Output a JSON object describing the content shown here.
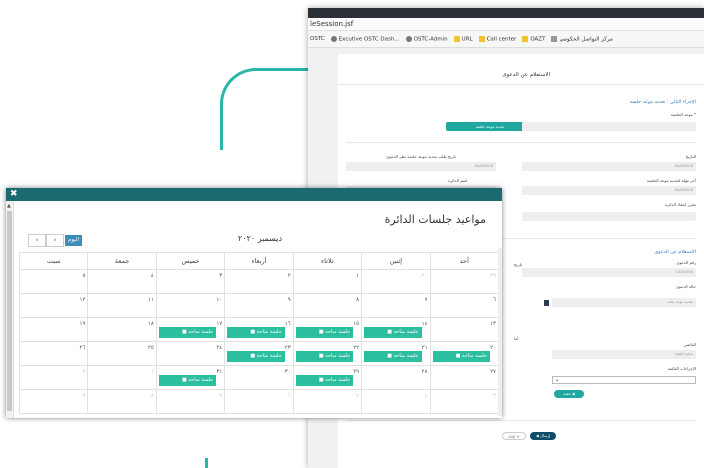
{
  "browser": {
    "url": "leSession.jsf",
    "bookmarks": [
      "OSTC",
      "Excutive OSTC Dash...",
      "OSTC-Admin",
      "URL",
      "Call center",
      "OAZT",
      "مركز التواصل الحكومي"
    ]
  },
  "form": {
    "page_title": "الاستعلام عن الدعوى",
    "section_action": "الإجراء التالي : تحديد موعد جلسة",
    "session_date_label": "موعد الجلسة *",
    "set_date_button": "تحديد موعد جلسة",
    "date_label": "التاريخ",
    "date_value": "00/00/000",
    "req_date_label": "تاريخ طلب تحديد موعد جلسة نظر الدعوى",
    "req_date_value": "00/00/000",
    "last_deadline_label": "آخر مهلة لتحديد موعد الجلسة",
    "last_deadline_value": "00/00/000",
    "circuit_label": "اسم الدائرة",
    "circuit_value": "",
    "circuit_members_label": "مقرر انعقاد الدائرة",
    "section_inquiry": "الاستعلام عن الدعوى",
    "case_no_label": "رقم الدعوى",
    "case_no_value": "1400/000",
    "case_status_label": "حالة الدعوى",
    "case_status_value": "جلسة موعد عامة",
    "judge_label": "القاضي",
    "judge_value": "تسلية اللجنة",
    "procedures_label": "الإجراءات القائمة",
    "procedures_select": "⌄",
    "next_chip": "تنفيذ ◀",
    "send_button": "◀ إرسال",
    "back_button": "إلغاء ✕",
    "side_label_1": "تاريخ",
    "side_label_2": "أما"
  },
  "calendar": {
    "window_close": "✖",
    "title": "مواعيد جلسات الدائرة",
    "month_label": "ديسمبر ٢٠٢٠",
    "today_label": "اليوم",
    "prev": "‹",
    "next": "›",
    "weekdays": [
      "سبت",
      "جمعة",
      "خميس",
      "أربعاء",
      "ثلاثاء",
      "إثنين",
      "أحد"
    ],
    "weeks": [
      [
        {
          "d": "٥"
        },
        {
          "d": "٤"
        },
        {
          "d": "٣"
        },
        {
          "d": "٢"
        },
        {
          "d": "١"
        },
        {
          "d": "٣٠",
          "f": true
        },
        {
          "d": "٢٩",
          "f": true
        }
      ],
      [
        {
          "d": "١٢"
        },
        {
          "d": "١١"
        },
        {
          "d": "١٠"
        },
        {
          "d": "٩"
        },
        {
          "d": "٨"
        },
        {
          "d": "٧"
        },
        {
          "d": "٦"
        }
      ],
      [
        {
          "d": "١٩"
        },
        {
          "d": "١٨"
        },
        {
          "d": "١٧",
          "ev": "■ جلسة متاحة"
        },
        {
          "d": "١٦",
          "ev": "■ جلسة متاحة"
        },
        {
          "d": "١٥",
          "ev": "■ جلسة متاحة"
        },
        {
          "d": "١٤",
          "ev": "■ جلسة متاحة"
        },
        {
          "d": "١٣"
        }
      ],
      [
        {
          "d": "٢٦"
        },
        {
          "d": "٢٥"
        },
        {
          "d": "٢٤"
        },
        {
          "d": "٢٣",
          "ev": "■ جلسة متاحة"
        },
        {
          "d": "٢٢",
          "ev": "■ جلسة متاحة"
        },
        {
          "d": "٢١",
          "ev": "■ جلسة متاحة"
        },
        {
          "d": "٢٠",
          "ev": "■ جلسة متاحة"
        }
      ],
      [
        {
          "d": "٢",
          "f": true
        },
        {
          "d": "١",
          "f": true
        },
        {
          "d": "٣١",
          "ev": "■ جلسة متاحة"
        },
        {
          "d": "٣٠"
        },
        {
          "d": "٢٩",
          "ev": "■ جلسة متاحة"
        },
        {
          "d": "٢٨"
        },
        {
          "d": "٢٧"
        }
      ],
      [
        {
          "d": "٩",
          "f": true
        },
        {
          "d": "٨",
          "f": true
        },
        {
          "d": "٧",
          "f": true
        },
        {
          "d": "٦",
          "f": true
        },
        {
          "d": "٥",
          "f": true
        },
        {
          "d": "٤",
          "f": true
        },
        {
          "d": "٣",
          "f": true
        }
      ]
    ]
  },
  "colors": {
    "accent": "#1fa8a0",
    "event": "#2bbfa0",
    "titlebar": "#1a6a70",
    "today": "#3c8dbc"
  }
}
